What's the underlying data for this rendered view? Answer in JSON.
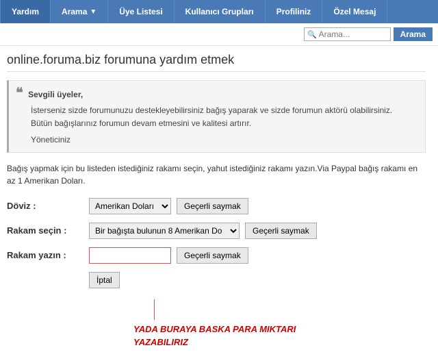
{
  "navbar": {
    "items": [
      {
        "label": "Yardım",
        "has_dropdown": false
      },
      {
        "label": "Arama",
        "has_dropdown": true
      },
      {
        "label": "Üye Listesi",
        "has_dropdown": false
      },
      {
        "label": "Kullanıcı Grupları",
        "has_dropdown": false
      },
      {
        "label": "Profiliniz",
        "has_dropdown": false
      },
      {
        "label": "Özel Mesaj",
        "has_dropdown": false
      }
    ]
  },
  "search": {
    "placeholder": "Arama...",
    "button_label": "Arama"
  },
  "page": {
    "title": "online.foruma.biz forumuna yardım etmek",
    "quote": {
      "salutation": "Sevgili üyeler,",
      "line1": "İsterseniz sizde forumunuzu destekleyebilirsiniz bağış yaparak ve sizde forumun aktörü olabilirsiniz.",
      "line2": "Bütün bağışlarınız forumun devam etmesini ve kalitesi artırır.",
      "signature": "Yöneticiniz"
    },
    "description": "Bağış yapmak için bu listeden istediğiniz rakamı seçin, yahut istediğiniz rakamı yazın.Via Paypal bağış rakamı en az 1 Amerikan Doları.",
    "form": {
      "currency_label": "Döviz :",
      "currency_option": "Amerikan Doları",
      "currency_validate": "Geçerli saymak",
      "amount_label": "Rakam seçin :",
      "amount_option": "Bir bağışta bulunun 8 Amerikan Do",
      "amount_validate": "Geçerli saymak",
      "write_label": "Rakam yazın :",
      "write_validate": "Geçerli saymak",
      "cancel_label": "İptal"
    },
    "note": "YADA BURAYA BASKA PARA MIKTARI\nYAZABILIRIZ"
  }
}
